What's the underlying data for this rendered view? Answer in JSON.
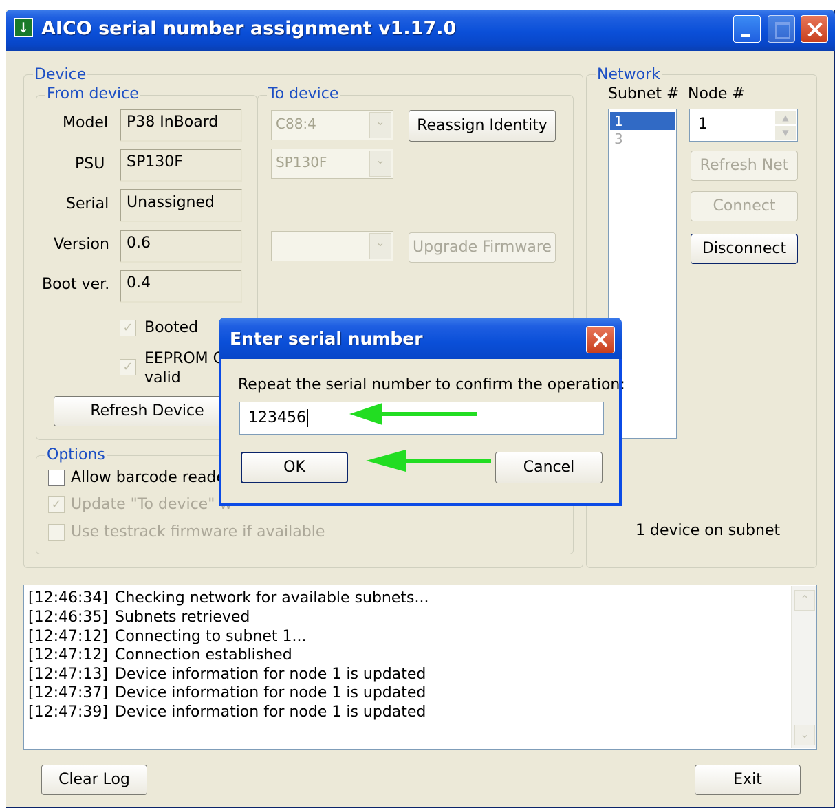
{
  "window": {
    "title": "AICO serial number assignment v1.17.0",
    "icon": "download-arrow-icon"
  },
  "device": {
    "group_label": "Device",
    "from_label": "From device",
    "to_label": "To device",
    "fields": {
      "model_label": "Model",
      "model_value": "P38 InBoard",
      "psu_label": "PSU",
      "psu_value": "SP130F",
      "serial_label": "Serial",
      "serial_value": "Unassigned",
      "version_label": "Version",
      "version_value": "0.6",
      "boot_label": "Boot ver.",
      "boot_value": "0.4"
    },
    "booted_label": "Booted",
    "eeprom_label_1": "EEPROM C",
    "eeprom_label_2": "valid",
    "refresh_device": "Refresh Device",
    "to_model_value": "C88:4",
    "to_psu_value": "SP130F",
    "reassign_identity": "Reassign Identity",
    "upgrade_firmware": "Upgrade Firmware"
  },
  "options": {
    "group_label": "Options",
    "allow_barcode": "Allow barcode reader",
    "update_to_device": "Update \"To device\" w",
    "use_testrack": "Use testrack firmware if available"
  },
  "network": {
    "group_label": "Network",
    "subnet_label": "Subnet #",
    "node_label": "Node #",
    "subnets": [
      "1",
      "3"
    ],
    "node_value": "1",
    "refresh_net": "Refresh Net",
    "connect": "Connect",
    "disconnect": "Disconnect",
    "status": "1 device on subnet"
  },
  "log": {
    "lines": [
      {
        "time": "[12:46:34]",
        "msg": "Checking network for available subnets..."
      },
      {
        "time": "[12:46:35]",
        "msg": "Subnets retrieved"
      },
      {
        "time": "[12:47:12]",
        "msg": "Connecting to subnet 1..."
      },
      {
        "time": "[12:47:12]",
        "msg": "Connection established"
      },
      {
        "time": "[12:47:13]",
        "msg": "Device information for node 1 is updated"
      },
      {
        "time": "[12:47:37]",
        "msg": "Device information for node 1 is updated"
      },
      {
        "time": "[12:47:39]",
        "msg": "Device information for node 1 is updated"
      }
    ]
  },
  "footer": {
    "clear_log": "Clear Log",
    "exit": "Exit"
  },
  "dialog": {
    "title": "Enter serial number",
    "prompt": "Repeat the serial number to confirm the operation:",
    "input_value": "123456",
    "ok": "OK",
    "cancel": "Cancel",
    "arrow_color": "#22dd22"
  }
}
